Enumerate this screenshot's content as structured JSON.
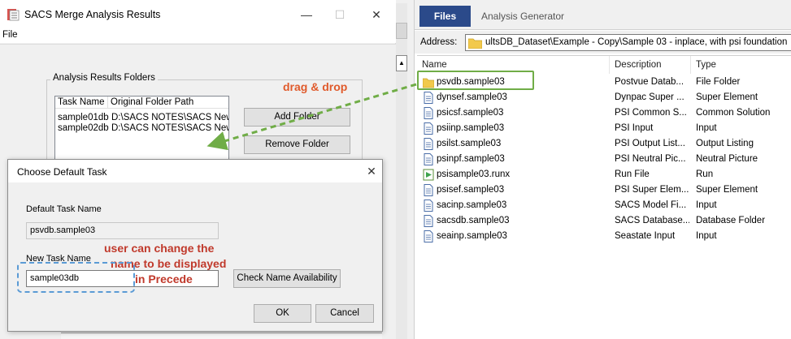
{
  "left_window": {
    "title": "SACS Merge Analysis Results",
    "menu_file": "File",
    "group_label": "Analysis Results Folders",
    "list_headers": [
      "Task Name",
      "Original Folder Path"
    ],
    "list_rows": [
      {
        "task": "sample01db",
        "path": "D:\\SACS NOTES\\SACS New Fe"
      },
      {
        "task": "sample02db",
        "path": "D:\\SACS NOTES\\SACS New Fe"
      }
    ],
    "add_folder": "Add Folder",
    "remove_folder": "Remove Folder"
  },
  "dialog": {
    "title": "Choose Default Task",
    "default_label": "Default Task Name",
    "default_value": "psvdb.sample03",
    "new_label": "New Task Name",
    "new_value": "sample03db",
    "check_button": "Check Name Availability",
    "ok": "OK",
    "cancel": "Cancel"
  },
  "explorer": {
    "tab_files": "Files",
    "tab_generator": "Analysis Generator",
    "address_label": "Address:",
    "address_value": "ultsDB_Dataset\\Example - Copy\\Sample 03 - inplace, with psi foundation",
    "headers": {
      "name": "Name",
      "description": "Description",
      "type": "Type"
    },
    "files": [
      {
        "name": "psvdb.sample03",
        "description": "Postvue Datab...",
        "type": "File Folder",
        "icon": "folder-icon"
      },
      {
        "name": "dynsef.sample03",
        "description": "Dynpac Super ...",
        "type": "Super Element",
        "icon": "document-icon"
      },
      {
        "name": "psicsf.sample03",
        "description": "PSI Common S...",
        "type": "Common Solution",
        "icon": "document-icon"
      },
      {
        "name": "psiinp.sample03",
        "description": "PSI Input",
        "type": "Input",
        "icon": "document-icon"
      },
      {
        "name": "psilst.sample03",
        "description": "PSI Output List...",
        "type": "Output Listing",
        "icon": "document-icon"
      },
      {
        "name": "psinpf.sample03",
        "description": "PSI Neutral Pic...",
        "type": "Neutral Picture",
        "icon": "document-icon"
      },
      {
        "name": "psisample03.runx",
        "description": "Run File",
        "type": "Run",
        "icon": "run-icon"
      },
      {
        "name": "psisef.sample03",
        "description": "PSI Super Elem...",
        "type": "Super Element",
        "icon": "document-icon"
      },
      {
        "name": "sacinp.sample03",
        "description": "SACS Model Fi...",
        "type": "Input",
        "icon": "document-icon"
      },
      {
        "name": "sacsdb.sample03",
        "description": "SACS Database...",
        "type": "Database Folder",
        "icon": "document-icon"
      },
      {
        "name": "seainp.sample03",
        "description": "Seastate Input",
        "type": "Input",
        "icon": "document-icon"
      }
    ]
  },
  "annotations": {
    "drag": "drag & drop",
    "user_line1": "user can change the",
    "user_line2": "name to be displayed",
    "user_line3": "in Precede",
    "colors": {
      "green": "#70ad47",
      "blue": "#5b9bd5",
      "red": "#c0392b",
      "orange": "#e05a2b"
    }
  }
}
